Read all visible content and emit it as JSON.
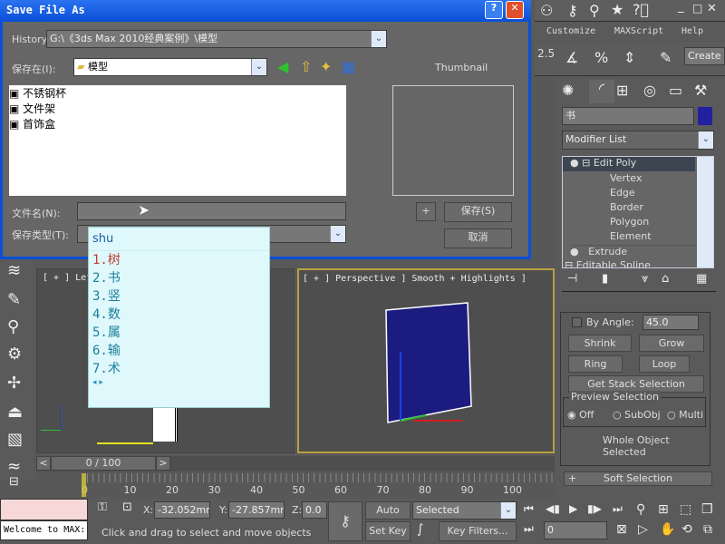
{
  "dialog": {
    "title": "Save File As",
    "history_label": "History:",
    "history_value": "G:\\《3ds Max 2010经典案例》\\模型",
    "save_in_label": "保存在(I):",
    "save_in_value": "模型",
    "thumbnail_label": "Thumbnail",
    "files": [
      "不锈钢杯",
      "文件架",
      "首饰盒"
    ],
    "filename_label": "文件名(N):",
    "filename_value": "",
    "filetype_label": "保存类型(T):",
    "plus_label": "+",
    "save_label": "保存(S)",
    "cancel_label": "取消"
  },
  "ime": {
    "input": "shu",
    "candidates": [
      "1.树",
      "2.书",
      "3.竖",
      "4.数",
      "5.属",
      "6.输",
      "7.术"
    ]
  },
  "menu": {
    "items": [
      "Customize",
      "MAXScript",
      "Help"
    ]
  },
  "toolbar": {
    "create_label": "Create",
    "snap_value": "2.5"
  },
  "command_panel": {
    "object_name": "书",
    "object_color": "#2020a0",
    "modifier_list": "Modifier List",
    "stack": [
      {
        "label": "Edit Poly",
        "selected": true
      },
      {
        "label": "Vertex"
      },
      {
        "label": "Edge"
      },
      {
        "label": "Border"
      },
      {
        "label": "Polygon"
      },
      {
        "label": "Element"
      },
      {
        "label": "Extrude"
      },
      {
        "label": "Editable Spline"
      }
    ],
    "by_angle_label": "By Angle:",
    "by_angle_value": "45.0",
    "shrink": "Shrink",
    "grow": "Grow",
    "ring": "Ring",
    "loop": "Loop",
    "get_stack": "Get Stack Selection",
    "preview_label": "Preview Selection",
    "preview_options": [
      "Off",
      "SubObj",
      "Multi"
    ],
    "preview_selected": "Off",
    "status": "Whole Object Selected",
    "soft_selection": "Soft Selection",
    "soft_plus": "+"
  },
  "viewports": {
    "left": "[ + ] Left",
    "perspective": "[ + ] Perspective ] Smooth + Highlights ]"
  },
  "timeline": {
    "frame": "0 / 100",
    "ticks": [
      "0",
      "10",
      "20",
      "30",
      "40",
      "50",
      "60",
      "70",
      "80",
      "90",
      "100"
    ]
  },
  "status": {
    "welcome": "Welcome to MAX:",
    "x_label": "X:",
    "x": "-32.052mm",
    "y_label": "Y:",
    "y": "-27.857mm",
    "z_label": "Z:",
    "z": "0.0",
    "auto_key": "Auto Key",
    "selected": "Selected",
    "set_key": "Set Key",
    "key_filters": "Key Filters...",
    "frame_value": "0",
    "prompt": "Click and drag to select and move objects"
  }
}
